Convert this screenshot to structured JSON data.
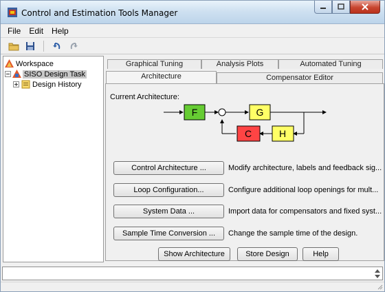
{
  "window": {
    "title": "Control and Estimation Tools Manager",
    "buttons": [
      "minimize-icon",
      "maximize-icon",
      "close-icon"
    ]
  },
  "menubar": {
    "items": [
      "File",
      "Edit",
      "Help"
    ]
  },
  "toolbar": {
    "icons": [
      "open-folder-icon",
      "save-icon",
      "undo-icon",
      "redo-icon"
    ]
  },
  "tree": {
    "root": "Workspace",
    "task": "SISO Design Task",
    "history": "Design History"
  },
  "tabs": {
    "row1": [
      "Graphical Tuning",
      "Analysis Plots",
      "Automated Tuning"
    ],
    "row2": [
      "Architecture",
      "Compensator Editor"
    ],
    "active": "Architecture"
  },
  "architecture": {
    "current_label": "Current Architecture:",
    "blocks": {
      "F": {
        "label": "F",
        "color": "#66cc33"
      },
      "G": {
        "label": "G",
        "color": "#ffff66"
      },
      "C": {
        "label": "C",
        "color": "#ff4444"
      },
      "H": {
        "label": "H",
        "color": "#ffff66"
      }
    }
  },
  "actions": [
    {
      "button": "Control Architecture ...",
      "description": "Modify architecture, labels and feedback sig..."
    },
    {
      "button": "Loop Configuration...",
      "description": "Configure additional loop openings for mult..."
    },
    {
      "button": "System Data ...",
      "description": "Import data for compensators and fixed syst..."
    },
    {
      "button": "Sample Time Conversion ...",
      "description": "Change the sample time of the design."
    }
  ],
  "footer_buttons": {
    "show": "Show Architecture",
    "store": "Store Design",
    "help": "Help"
  },
  "status": {
    "text": ""
  }
}
